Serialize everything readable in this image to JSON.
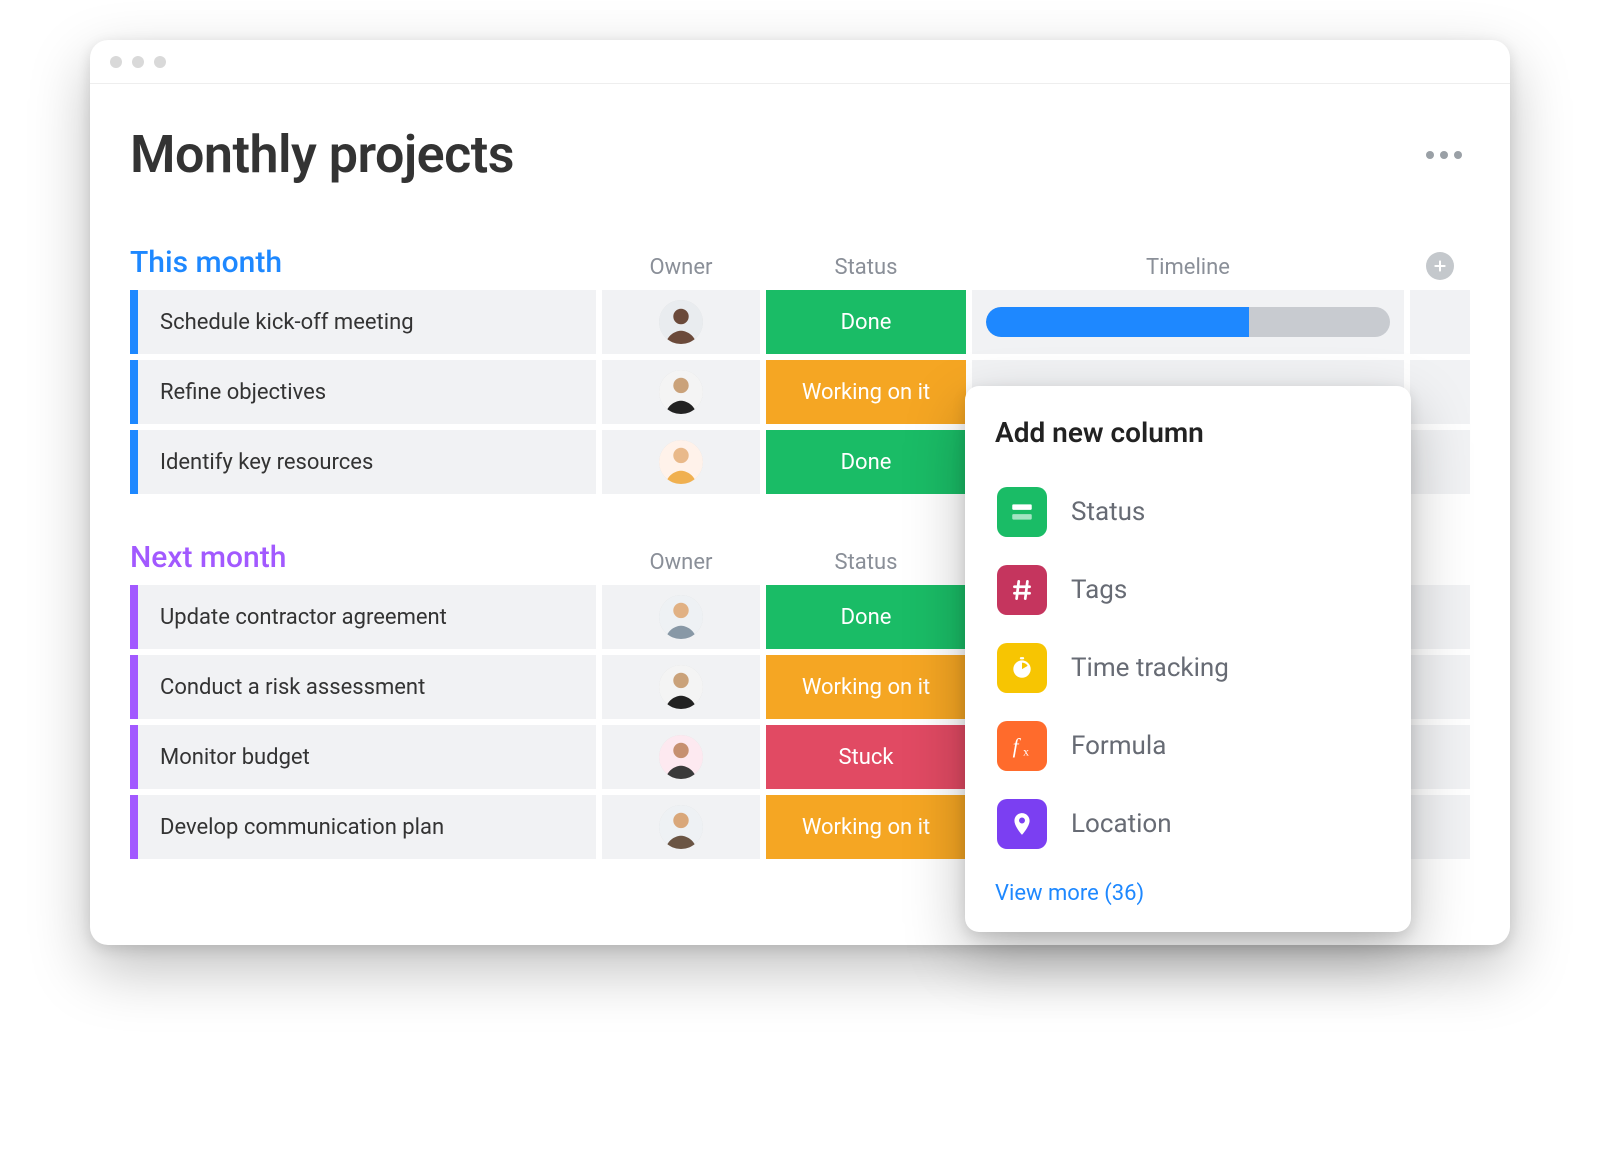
{
  "board": {
    "title": "Monthly projects",
    "columns": {
      "owner": "Owner",
      "status": "Status",
      "timeline": "Timeline"
    }
  },
  "groups": [
    {
      "title": "This month",
      "color": "blue",
      "rows": [
        {
          "item": "Schedule kick-off meeting",
          "status": "Done",
          "status_key": "done",
          "timeline_fill": 65
        },
        {
          "item": "Refine objectives",
          "status": "Working on it",
          "status_key": "working"
        },
        {
          "item": "Identify key resources",
          "status": "Done",
          "status_key": "done"
        }
      ]
    },
    {
      "title": "Next month",
      "color": "purple",
      "rows": [
        {
          "item": "Update contractor agreement",
          "status": "Done",
          "status_key": "done"
        },
        {
          "item": "Conduct a risk assessment",
          "status": "Working on it",
          "status_key": "working"
        },
        {
          "item": "Monitor budget",
          "status": "Stuck",
          "status_key": "stuck"
        },
        {
          "item": "Develop communication plan",
          "status": "Working on it",
          "status_key": "working"
        }
      ]
    }
  ],
  "popover": {
    "title": "Add new column",
    "items": [
      {
        "label": "Status",
        "icon": "status"
      },
      {
        "label": "Tags",
        "icon": "tags"
      },
      {
        "label": "Time tracking",
        "icon": "time"
      },
      {
        "label": "Formula",
        "icon": "formula"
      },
      {
        "label": "Location",
        "icon": "location"
      }
    ],
    "view_more": "View more (36)"
  }
}
